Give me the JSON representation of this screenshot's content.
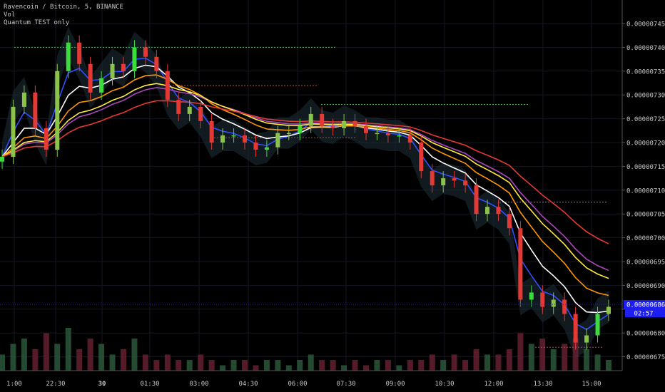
{
  "legend": {
    "symbol": "Ravencoin / Bitcoin, 5, BINANCE",
    "indicator1": "Vol",
    "indicator2": "Quantum TEST only"
  },
  "chart_data": {
    "type": "candlestick",
    "price_axis": {
      "ticks": [
        "0.00000745",
        "0.00000740",
        "0.00000735",
        "0.00000730",
        "0.00000725",
        "0.00000720",
        "0.00000715",
        "0.00000710",
        "0.00000705",
        "0.00000700",
        "0.00000695",
        "0.00000690",
        "0.00000685",
        "0.00000680",
        "0.00000675"
      ],
      "range": [
        6.71e-06,
        7.49e-06
      ]
    },
    "time_axis": {
      "ticks": [
        "1:00",
        "22:30",
        "30",
        "01:30",
        "03:00",
        "04:30",
        "06:00",
        "07:30",
        "09:00",
        "10:30",
        "12:00",
        "13:30",
        "15:00"
      ]
    },
    "closes_e8": [
      717,
      727.5,
      730.5,
      723,
      718.5,
      735,
      741,
      736.5,
      730.5,
      733.5,
      736.5,
      735,
      740,
      738,
      735,
      729,
      726,
      727.5,
      724.5,
      720,
      721.5,
      721.5,
      720,
      718.5,
      719,
      722,
      722,
      723.5,
      726,
      723.5,
      723,
      724.5,
      723.5,
      722,
      722,
      721.5,
      721.5,
      720,
      714,
      711,
      712.5,
      712,
      711,
      705,
      706.5,
      705,
      702,
      687,
      688.5,
      685.5,
      687,
      684,
      678,
      679.5,
      684,
      685.5
    ],
    "volume": [
      3,
      5,
      6,
      4,
      7,
      5,
      8,
      4,
      6,
      5,
      3,
      4,
      6,
      3,
      2,
      3,
      2,
      2,
      3,
      2,
      1,
      2,
      2,
      1,
      2,
      2,
      1,
      2,
      3,
      2,
      2,
      1,
      2,
      1,
      2,
      2,
      1,
      2,
      2,
      3,
      2,
      3,
      2,
      4,
      3,
      3,
      4,
      7,
      5,
      6,
      4,
      5,
      6,
      4,
      3,
      2
    ],
    "moving_averages": [
      {
        "period": 3,
        "color": "#3050ff"
      },
      {
        "period": 6,
        "color": "#ffffff"
      },
      {
        "period": 10,
        "color": "#ff9800"
      },
      {
        "period": 16,
        "color": "#ab47bc"
      },
      {
        "period": 14,
        "color": "#ffeb3b"
      },
      {
        "period": 24,
        "color": "#e53935"
      }
    ],
    "levels": [
      {
        "price_e8": 740,
        "color": "#4caf50"
      },
      {
        "price_e8": 732,
        "color": "#e53935"
      },
      {
        "price_e8": 728,
        "color": "#4caf50"
      },
      {
        "price_e8": 721,
        "color": "#e53935"
      },
      {
        "price_e8": 707.5,
        "color": "#4caf50"
      },
      {
        "price_e8": 677,
        "color": "#e53935"
      }
    ],
    "up_color": "#4caf50",
    "down_color": "#e53935",
    "last_price": "0.00000686",
    "countdown": "02:57",
    "last_price_color": "#1e1ef0"
  }
}
